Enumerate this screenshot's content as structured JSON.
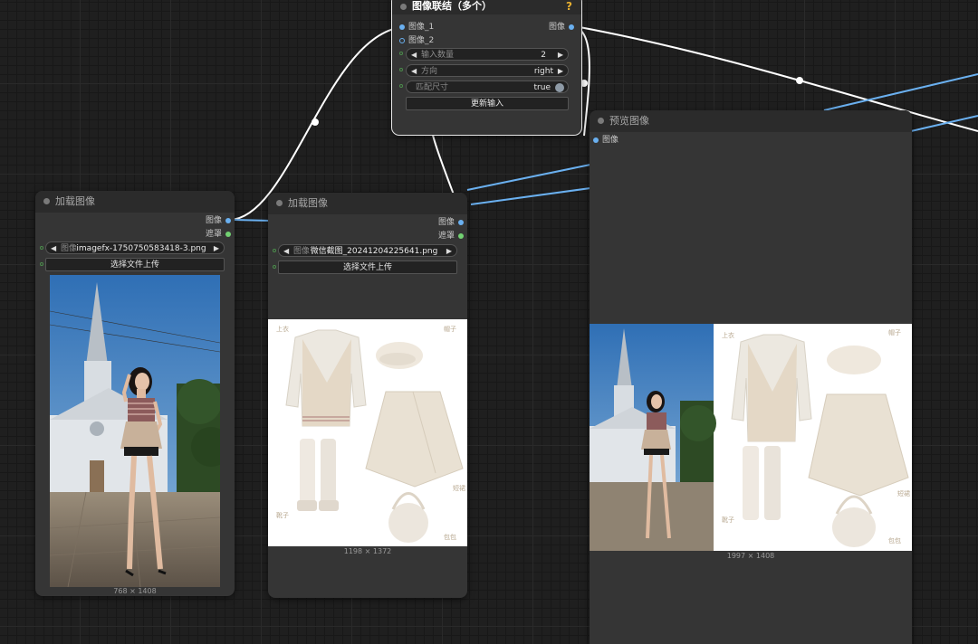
{
  "nodes": {
    "concat": {
      "title": "图像联结（多个）",
      "help": "?",
      "inputs": [
        "图像_1",
        "图像_2"
      ],
      "output": "图像",
      "widgets": {
        "count_label": "输入数量",
        "count_value": "2",
        "direction_label": "方向",
        "direction_value": "right",
        "match_label": "匹配尺寸",
        "match_value": "true"
      },
      "button": "更新输入"
    },
    "load1": {
      "title": "加载图像",
      "outputs": [
        "图像",
        "遮罩"
      ],
      "image_label": "图像",
      "image_value": "imagefx-1750750583418-3.png",
      "upload": "选择文件上传",
      "dims": "768 × 1408"
    },
    "load2": {
      "title": "加载图像",
      "outputs": [
        "图像",
        "遮罩"
      ],
      "image_label": "图像",
      "image_value": "微信截图_20241204225641.png",
      "upload": "选择文件上传",
      "dims": "1198 × 1372"
    },
    "preview": {
      "title": "预览图像",
      "input": "图像",
      "dims": "1997 × 1408"
    }
  },
  "outfit_labels": {
    "top": "上衣",
    "hat": "帽子",
    "skirt": "短裙",
    "boots": "靴子",
    "bag": "包包"
  },
  "colors": {
    "canvas": "#1f1f1f",
    "node_body": "#353535",
    "node_title": "#2b2b2b",
    "image_port": "#6ab0f0",
    "mask_port": "#72d172",
    "help": "#e8b030",
    "wire_image": "#6ab0f0"
  }
}
